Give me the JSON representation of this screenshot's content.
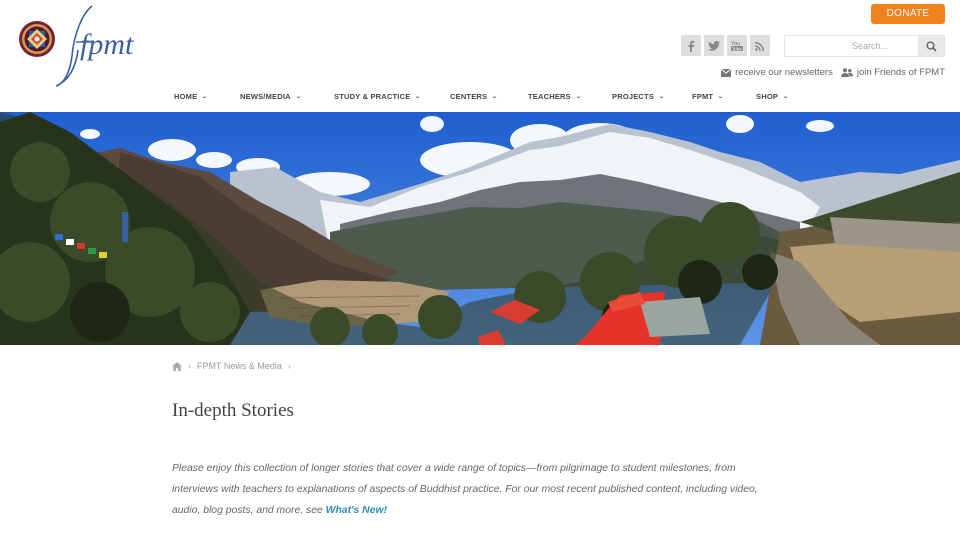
{
  "header": {
    "logo_text": "fpmt",
    "donate_label": "DONATE",
    "socials": [
      {
        "icon": "facebook-icon",
        "glyph": "f"
      },
      {
        "icon": "twitter-icon",
        "glyph": "t"
      },
      {
        "icon": "youtube-icon",
        "glyph": "You Tube"
      },
      {
        "icon": "rss-icon",
        "glyph": "rss"
      }
    ],
    "search": {
      "placeholder": "Search..."
    },
    "links": [
      {
        "label": "receive our newsletters",
        "icon": "envelope-icon"
      },
      {
        "label": "join Friends of FPMT",
        "icon": "users-icon"
      }
    ]
  },
  "nav": {
    "items": [
      {
        "label": "HOME"
      },
      {
        "label": "NEWS/MEDIA"
      },
      {
        "label": "STUDY & PRACTICE"
      },
      {
        "label": "CENTERS"
      },
      {
        "label": "TEACHERS"
      },
      {
        "label": "PROJECTS"
      },
      {
        "label": "FPMT"
      },
      {
        "label": "SHOP"
      }
    ]
  },
  "breadcrumb": {
    "home_icon": "home-icon",
    "items": [
      {
        "label": "FPMT News & Media"
      }
    ]
  },
  "page": {
    "title": "In-depth Stories",
    "intro_text": "Please enjoy this collection of longer stories that cover a wide range of topics—from pilgrimage to student milestones, from interviews with teachers to explanations of aspects of Buddhist practice. For our most recent published content, including video, audio, blog posts, and more, see ",
    "intro_link": "What's New!"
  },
  "colors": {
    "accent": "#f0821e",
    "link": "#2f8fc2",
    "logo": "#3b5fa0"
  }
}
